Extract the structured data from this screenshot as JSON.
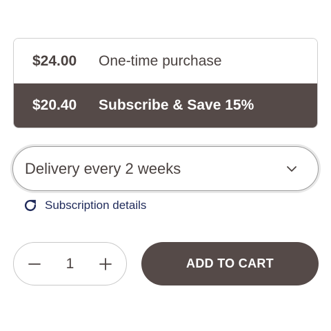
{
  "purchase_options": {
    "one_time": {
      "price": "$24.00",
      "label": "One-time purchase"
    },
    "subscribe": {
      "price": "$20.40",
      "label": "Subscribe & Save 15%"
    },
    "selected": "subscribe"
  },
  "delivery": {
    "selected_value": "Delivery every 2 weeks",
    "icon": "chevron-down-icon"
  },
  "subscription_link": {
    "label": "Subscription details",
    "icon": "refresh-icon"
  },
  "quantity": {
    "value": "1",
    "decrement_icon": "minus-icon",
    "increment_icon": "plus-icon"
  },
  "cart": {
    "button_label": "ADD TO CART"
  },
  "colors": {
    "accent_dark": "#554a48",
    "text": "#4a4240",
    "link": "#1f2a5a",
    "border": "#cfcfcf"
  }
}
